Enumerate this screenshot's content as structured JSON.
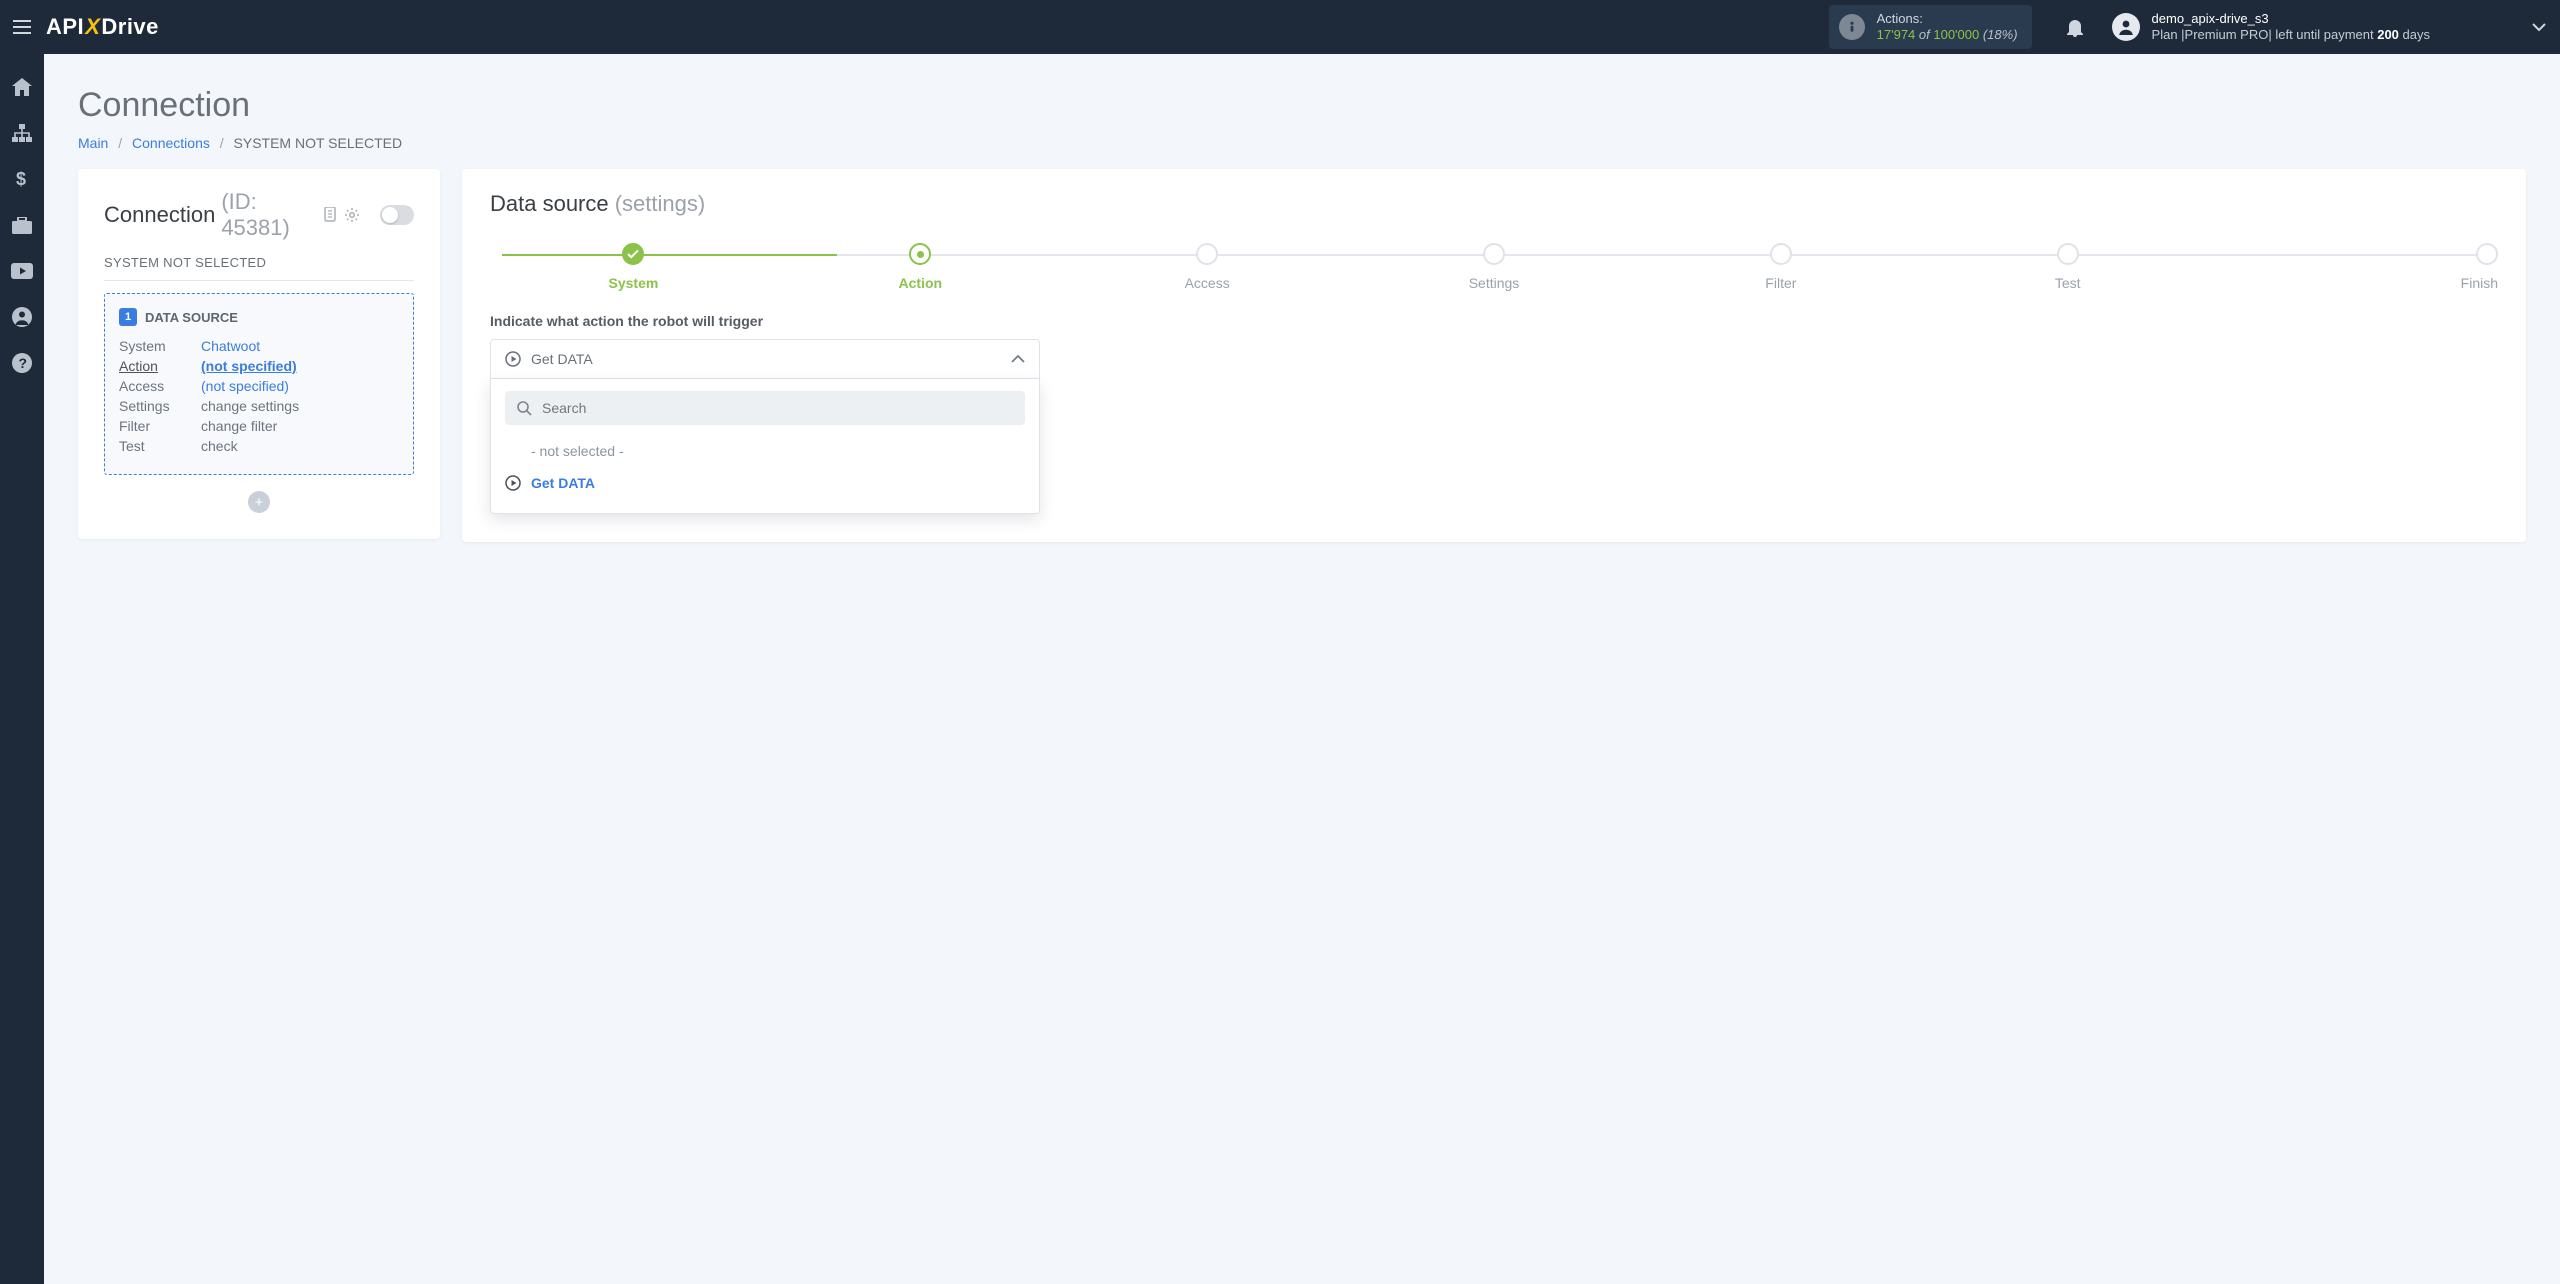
{
  "header": {
    "brand_left": "API",
    "brand_x": "X",
    "brand_right": "Drive",
    "actions_label": "Actions:",
    "actions_used": "17'974",
    "actions_of": " of ",
    "actions_total": "100'000",
    "actions_pct": " (18%)",
    "user_name": "demo_apix-drive_s3",
    "plan_prefix": "Plan |",
    "plan_name": "Premium PRO",
    "plan_mid": "| left until payment ",
    "plan_days": "200",
    "plan_suffix": " days"
  },
  "page": {
    "title": "Connection",
    "crumb_main": "Main",
    "crumb_connections": "Connections",
    "crumb_current": "SYSTEM NOT SELECTED"
  },
  "left_card": {
    "title": "Connection ",
    "id_label": "(ID: 45381)",
    "sns": "SYSTEM NOT SELECTED",
    "ds_badge": "1",
    "ds_title": "DATA SOURCE",
    "rows": {
      "system_k": "System",
      "system_v": "Chatwoot",
      "action_k": "Action",
      "action_v": "(not specified)",
      "access_k": "Access",
      "access_v": "(not specified)",
      "settings_k": "Settings",
      "settings_v": "change settings",
      "filter_k": "Filter",
      "filter_v": "change filter",
      "test_k": "Test",
      "test_v": "check"
    }
  },
  "right_card": {
    "title": "Data source ",
    "subtitle": "(settings)",
    "steps": [
      "System",
      "Action",
      "Access",
      "Settings",
      "Filter",
      "Test",
      "Finish"
    ],
    "instr": "Indicate what action the robot will trigger",
    "dd_selected": "Get DATA",
    "search_placeholder": "Search",
    "opt_none": "- not selected -",
    "opt_get": "Get DATA"
  }
}
